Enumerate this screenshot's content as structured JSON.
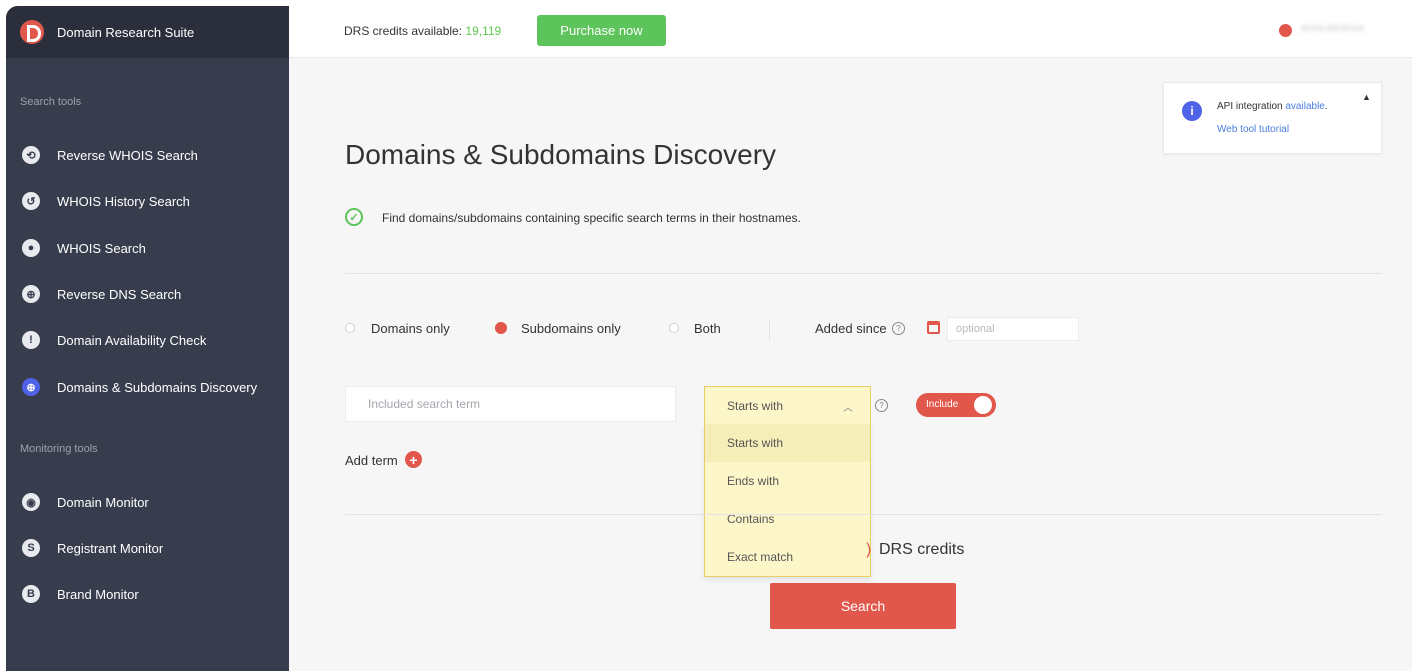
{
  "app": {
    "name": "Domain Research Suite"
  },
  "sidebar": {
    "search_section_label": "Search tools",
    "search_items": [
      {
        "label": "Reverse WHOIS Search",
        "icon": "reverse-whois-icon",
        "glyph": "⟲",
        "active": false
      },
      {
        "label": "WHOIS History Search",
        "icon": "whois-history-icon",
        "glyph": "↺",
        "active": false
      },
      {
        "label": "WHOIS Search",
        "icon": "whois-search-icon",
        "glyph": "●",
        "active": false
      },
      {
        "label": "Reverse DNS Search",
        "icon": "globe-icon",
        "glyph": "⊕",
        "active": false
      },
      {
        "label": "Domain Availability Check",
        "icon": "availability-icon",
        "glyph": "!",
        "active": false
      },
      {
        "label": "Domains & Subdomains Discovery",
        "icon": "discovery-globe-icon",
        "glyph": "⊕",
        "active": true
      }
    ],
    "monitoring_section_label": "Monitoring tools",
    "monitoring_items": [
      {
        "label": "Domain Monitor",
        "icon": "domain-monitor-icon",
        "glyph": "◉"
      },
      {
        "label": "Registrant Monitor",
        "icon": "registrant-monitor-icon",
        "glyph": "S"
      },
      {
        "label": "Brand Monitor",
        "icon": "brand-monitor-icon",
        "glyph": "B"
      }
    ]
  },
  "topbar": {
    "credits_label": "DRS credits available: ",
    "credits_value": "19,119",
    "purchase_label": "Purchase now",
    "username": "anna.danilova"
  },
  "api_box": {
    "line1_prefix": "API integration ",
    "line1_link": "available",
    "line1_suffix": ".",
    "tutorial_link": "Web tool tutorial"
  },
  "page": {
    "title": "Domains & Subdomains Discovery",
    "description": "Find domains/subdomains containing specific search terms in their hostnames."
  },
  "filters": {
    "options": [
      "Domains only",
      "Subdomains only",
      "Both"
    ],
    "selected_index": 1,
    "added_since_label": "Added since",
    "date_placeholder": "optional"
  },
  "term": {
    "placeholder": "Included search term",
    "match_selected": "Starts with",
    "match_options": [
      "Starts with",
      "Ends with",
      "Contains",
      "Exact match"
    ],
    "toggle_label": "Include",
    "add_term_label": "Add term"
  },
  "cost": {
    "value_fragment": ")",
    "label": "DRS credits"
  },
  "search_button": "Search",
  "colors": {
    "accent": "#e2574c",
    "sidebar": "#383d4d",
    "success": "#5cc45a",
    "link": "#4a7de0"
  }
}
